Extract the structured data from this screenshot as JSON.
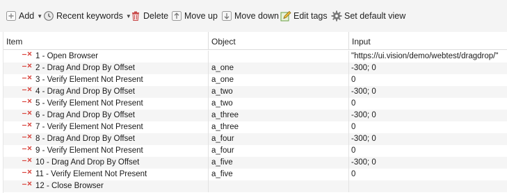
{
  "toolbar": {
    "add_label": "Add",
    "recent_label": "Recent keywords",
    "delete_label": "Delete",
    "move_up_label": "Move up",
    "move_down_label": "Move down",
    "edit_tags_label": "Edit tags",
    "set_default_view_label": "Set default view"
  },
  "columns": {
    "item": "Item",
    "object": "Object",
    "input": "Input"
  },
  "rows": [
    {
      "item": "1 - Open Browser",
      "object": "",
      "input": "\"https://ui.vision/demo/webtest/dragdrop/\""
    },
    {
      "item": "2 - Drag And Drop By Offset",
      "object": "a_one",
      "input": "-300; 0"
    },
    {
      "item": "3 - Verify Element Not Present",
      "object": "a_one",
      "input": "0"
    },
    {
      "item": "4 - Drag And Drop By Offset",
      "object": "a_two",
      "input": "-300; 0"
    },
    {
      "item": "5 - Verify Element Not Present",
      "object": "a_two",
      "input": "0"
    },
    {
      "item": "6 - Drag And Drop By Offset",
      "object": "a_three",
      "input": "-300; 0"
    },
    {
      "item": "7 - Verify Element Not Present",
      "object": "a_three",
      "input": "0"
    },
    {
      "item": "8 - Drag And Drop By Offset",
      "object": "a_four",
      "input": "-300; 0"
    },
    {
      "item": "9 - Verify Element Not Present",
      "object": "a_four",
      "input": "0"
    },
    {
      "item": "10 - Drag And Drop By Offset",
      "object": "a_five",
      "input": "-300; 0"
    },
    {
      "item": "11 - Verify Element Not Present",
      "object": "a_five",
      "input": "0"
    },
    {
      "item": "12 - Close Browser",
      "object": "",
      "input": ""
    }
  ],
  "colors": {
    "breakpoint_red": "#d9463f",
    "toolbar_bg": "#f4f4f4",
    "row_alt_bg": "#f5f5f5"
  }
}
